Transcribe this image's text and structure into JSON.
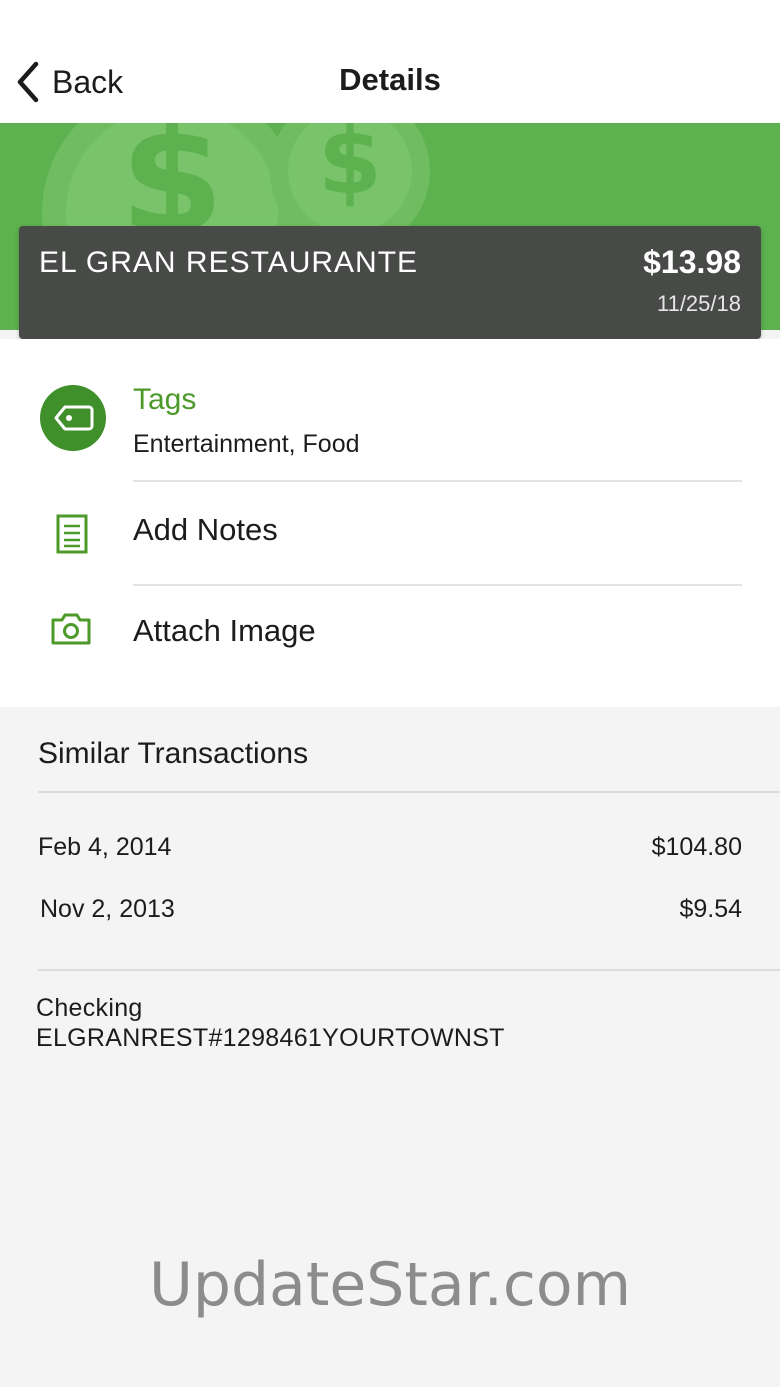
{
  "nav": {
    "back_label": "Back",
    "title": "Details"
  },
  "merchant": {
    "name": "EL GRAN RESTAURANTE",
    "amount": "$13.98",
    "date": "11/25/18"
  },
  "details": {
    "tags_title": "Tags",
    "tags_value": "Entertainment, Food",
    "notes_label": "Add Notes",
    "image_label": "Attach Image"
  },
  "similar": {
    "title": "Similar Transactions",
    "transactions": [
      {
        "date": "Feb 4, 2014",
        "amount": "$104.80"
      },
      {
        "date": "Nov 2, 2013",
        "amount": "$9.54"
      }
    ]
  },
  "account": {
    "type": "Checking",
    "description": "ELGRANREST#1298461YOURTOWNST"
  },
  "watermark": "UpdateStar.com",
  "colors": {
    "brand_green": "#5db14e",
    "accent_green": "#4c9a2a",
    "card_dark": "#474a47"
  }
}
